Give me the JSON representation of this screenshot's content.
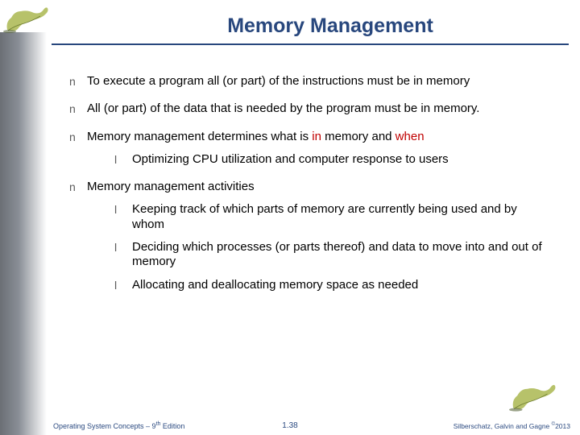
{
  "title": "Memory Management",
  "bullets": [
    {
      "text": "To execute a program all (or part) of the instructions must be in memory"
    },
    {
      "text": "All  (or part) of the data that is needed by the program must be in memory."
    },
    {
      "pre": "Memory management determines what is ",
      "r1": "in",
      " mid": " memory and ",
      "r2": "when",
      "sub": [
        {
          "text": "Optimizing CPU utilization and computer response to users"
        }
      ]
    },
    {
      "text": "Memory management activities",
      "sub": [
        {
          "text": "Keeping track of which parts of memory are currently being used and by whom"
        },
        {
          "text": "Deciding which processes (or parts thereof) and data to move into and out of memory"
        },
        {
          "text": "Allocating and deallocating memory space as needed"
        }
      ]
    }
  ],
  "footer": {
    "left_pre": "Operating System Concepts – 9",
    "left_sup": "th",
    "left_post": " Edition",
    "center": "1.38",
    "right_pre": "Silberschatz, Galvin and Gagne ",
    "right_sup": "©",
    "right_post": "2013"
  },
  "glyphs": {
    "level1": "n",
    "level2": "l"
  }
}
